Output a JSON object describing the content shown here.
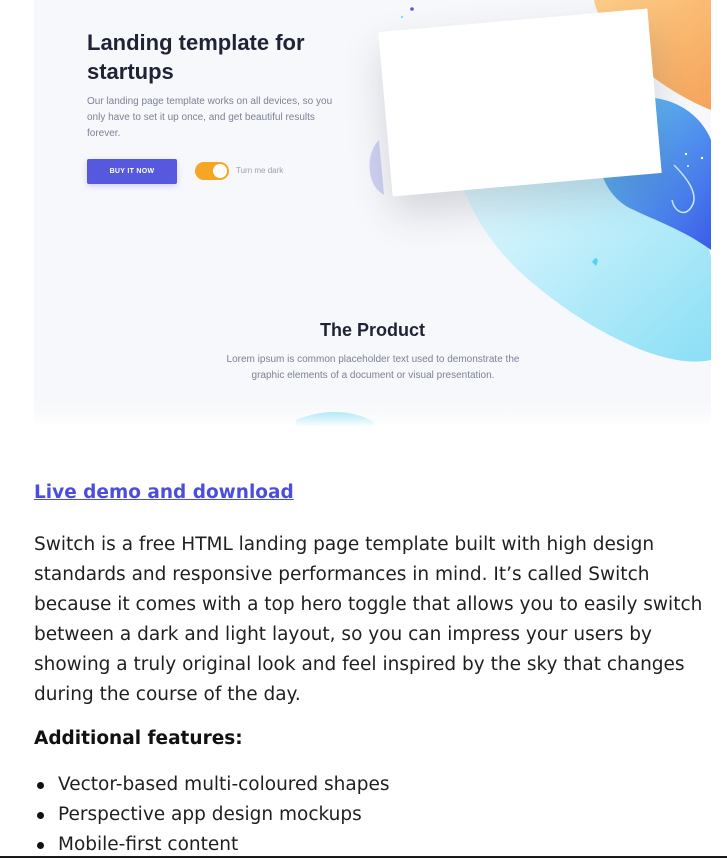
{
  "preview": {
    "hero_title": "Landing template for startups",
    "hero_description": "Our landing page template works on all devices, so you only have to set it up once, and get beautiful results forever.",
    "buy_button_label": "BUY IT NOW",
    "toggle_label": "Turn me dark",
    "toggle_on": true,
    "section_title": "The Product",
    "section_description": "Lorem ipsum is common placeholder text used to demonstrate the graphic elements of a document or visual presentation.",
    "colors": {
      "button": "#5658dd",
      "toggle": "#f6a623",
      "accent_blue": "#4f6ef0",
      "accent_orange": "#f9b46b"
    }
  },
  "article": {
    "demo_link_label": "Live demo and download",
    "intro": "Switch is a free HTML landing page template built with high design standards and responsive performances in mind. It’s called Switch because it comes with a top hero toggle that allows you to easily switch between a dark and light layout, so you can impress your users by showing a truly original look and feel inspired by the sky that changes during the course of the day.",
    "features_heading": "Additional features:",
    "features": [
      "Vector-based multi-coloured shapes",
      "Perspective app design mockups",
      "Mobile-first content"
    ],
    "link_color": "#4a4ee0"
  }
}
